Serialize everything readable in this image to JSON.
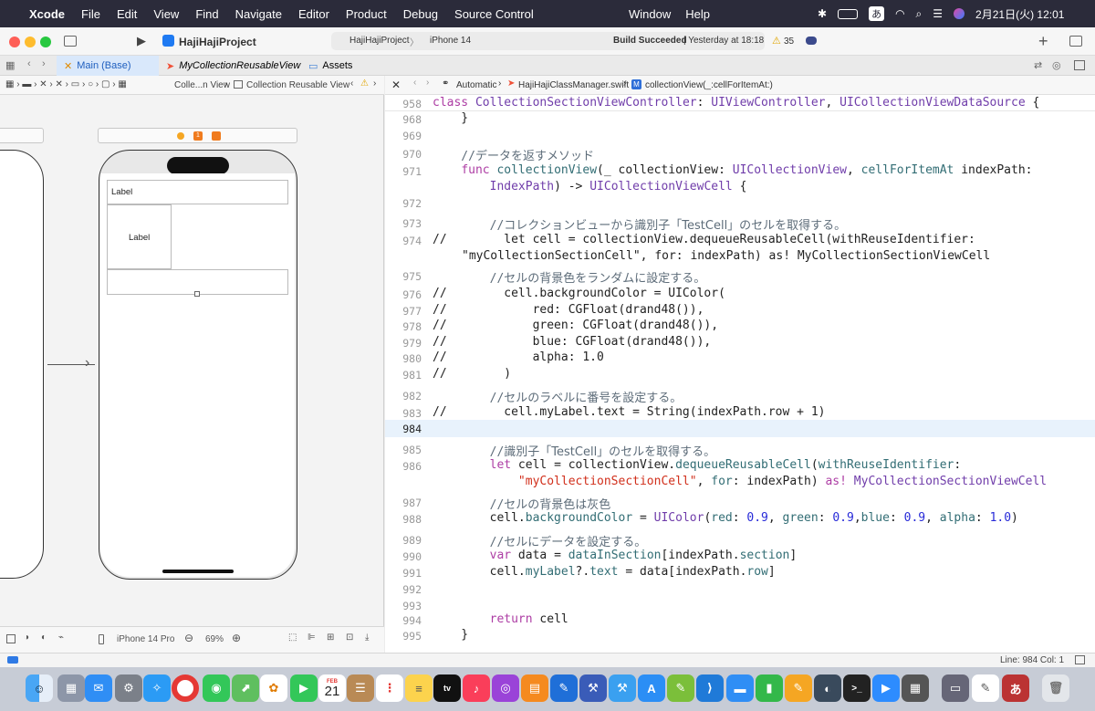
{
  "menubar": {
    "app": "Xcode",
    "items": [
      "File",
      "Edit",
      "View",
      "Find",
      "Navigate",
      "Editor",
      "Product",
      "Debug",
      "Source Control",
      "Window",
      "Help"
    ],
    "input_method": "あ",
    "datetime": "2月21日(火)  12:01"
  },
  "toolbar": {
    "project": "HajiHajiProject",
    "scheme": "HajiHajiProject",
    "destination": "iPhone 14",
    "build_status": "Build Succeeded",
    "build_time": "| Yesterday at 18:18",
    "warnings": "35"
  },
  "tabs": [
    {
      "label": "Main (Base)",
      "icon": "storyboard-icon"
    },
    {
      "label": "MyCollectionReusableView",
      "icon": "swift-icon"
    },
    {
      "label": "Assets",
      "icon": "assets-icon"
    }
  ],
  "canvas": {
    "jumpbar": [
      "Colle...n View",
      "Collection Reusable View"
    ],
    "label1": "Label",
    "label2": "Label",
    "scene_badges": [
      "",
      "1",
      ""
    ],
    "device": "iPhone 14 Pro",
    "zoom": "69%"
  },
  "editor": {
    "jumpbar": [
      "Automatic",
      "HajiHajiClassManager.swift",
      "collectionView(_:cellForItemAt:)"
    ],
    "status": "Line: 984  Col: 1"
  },
  "dock": {
    "calendar_day": "21",
    "calendar_month": "FEB"
  }
}
